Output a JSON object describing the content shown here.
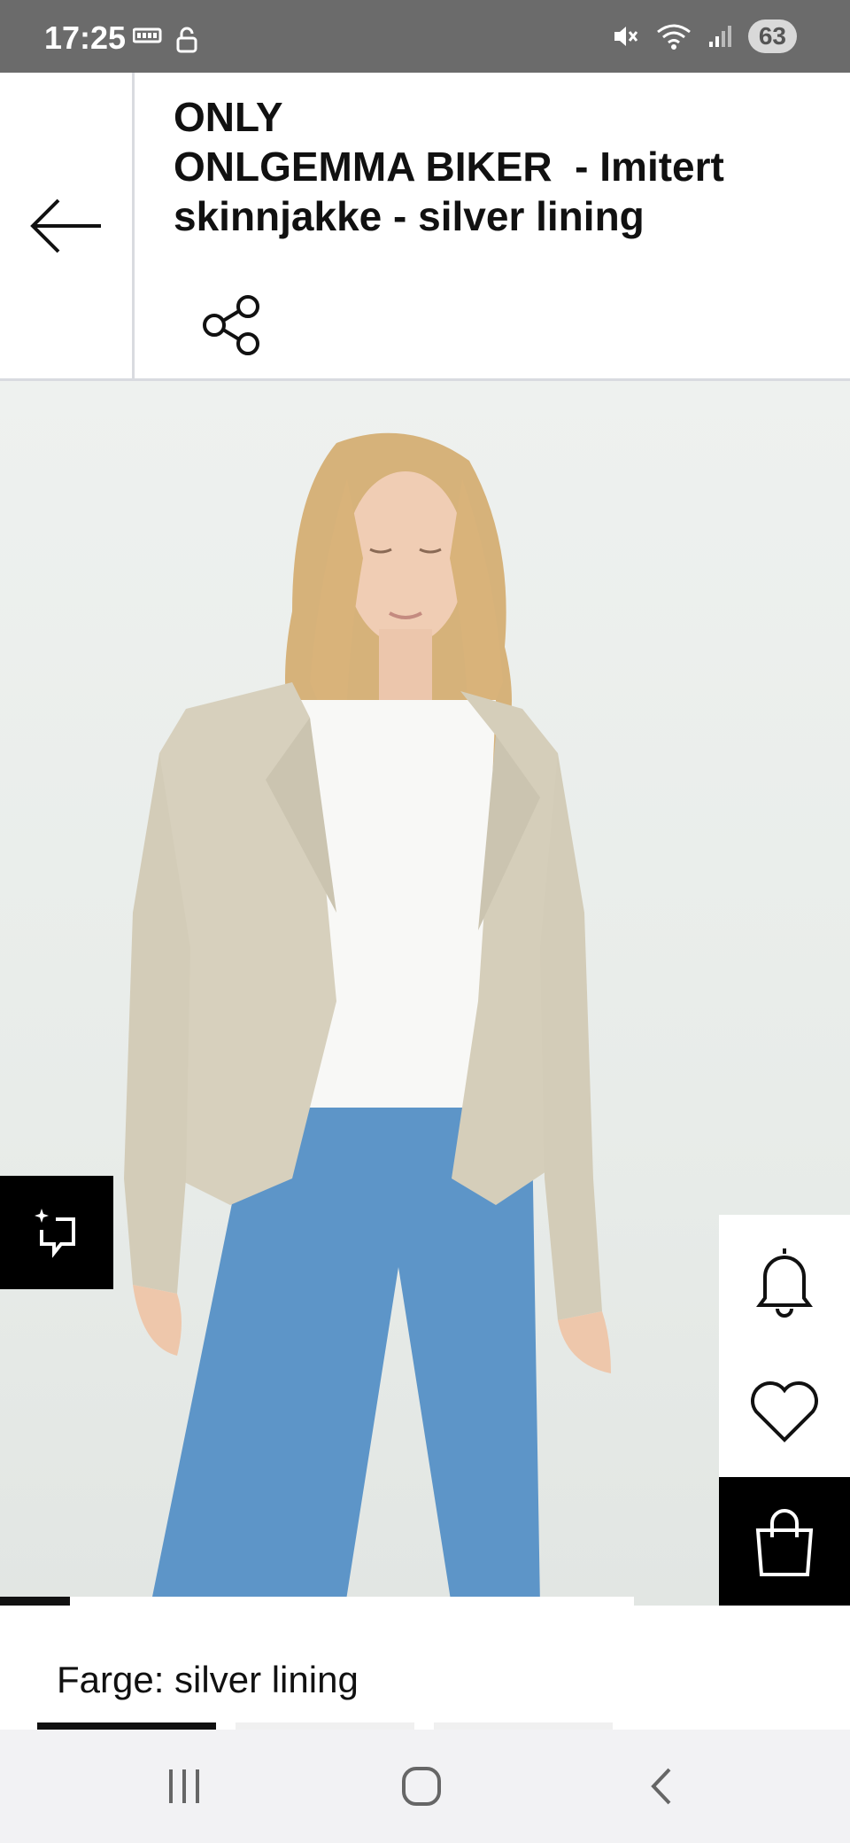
{
  "status_bar": {
    "time": "17:25",
    "battery": "63",
    "icons": [
      "battery-saver-icon",
      "unlock-icon",
      "mute-icon",
      "wifi-icon",
      "signal-icon"
    ]
  },
  "header": {
    "brand": "ONLY",
    "product_name": "ONLGEMMA BIKER  - Imitert skinnjakke - silver lining",
    "back_icon": "arrow-left-icon",
    "share_icon": "share-icon"
  },
  "gallery": {
    "image_alt": "product photo",
    "progress_fraction": 0.11
  },
  "actions": {
    "similar_icon": "ai-similar-icon",
    "notify_icon": "bell-icon",
    "wishlist_icon": "heart-icon",
    "cart_icon": "shopping-bag-icon"
  },
  "color": {
    "label": "Farge: silver lining"
  },
  "navbar": {
    "icons": [
      "recent-apps-icon",
      "home-icon",
      "back-icon"
    ]
  }
}
